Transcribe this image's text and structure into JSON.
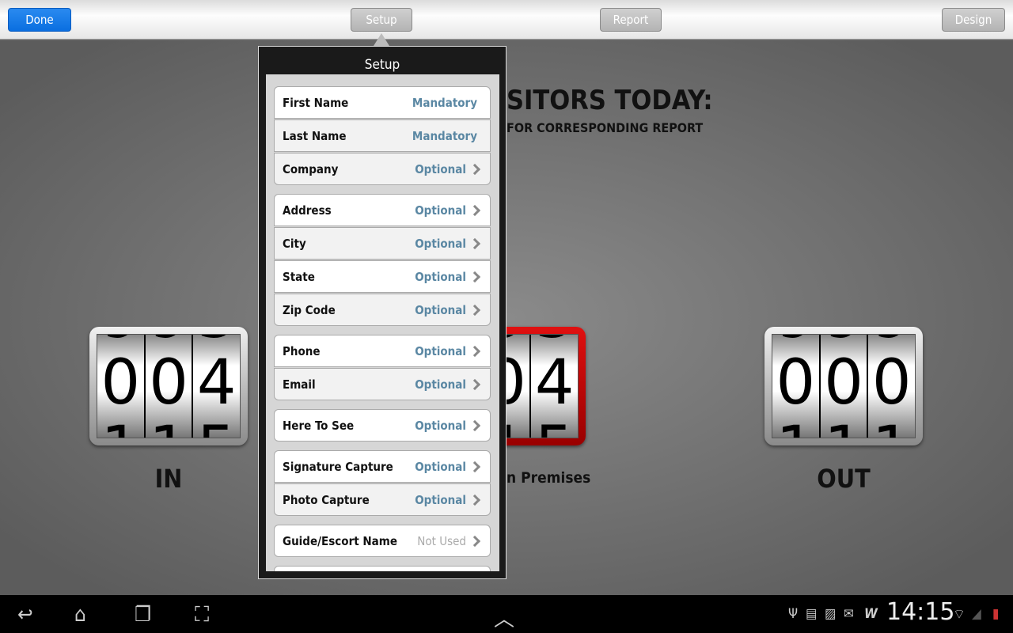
{
  "toolbar": {
    "done": "Done",
    "setup": "Setup",
    "report": "Report",
    "design": "Design",
    "accent": "#0a6fe0"
  },
  "main": {
    "title": "SITORS TODAY:",
    "subtitle": "FOR CORRESPONDING REPORT",
    "counters": [
      {
        "label": "IN",
        "digits": [
          "0",
          "0",
          "4"
        ],
        "prev": [
          "9",
          "9",
          "3"
        ],
        "next": [
          "1",
          "1",
          "5"
        ]
      },
      {
        "label": "n Premises",
        "digits": [
          "0",
          "4"
        ],
        "prev": [
          "9",
          "3"
        ],
        "next": [
          "1",
          "5"
        ],
        "color": "#cc0000"
      },
      {
        "label": "OUT",
        "digits": [
          "0",
          "0",
          "0"
        ],
        "prev": [
          "9",
          "9",
          "9"
        ],
        "next": [
          "1",
          "1",
          "1"
        ]
      }
    ]
  },
  "popup": {
    "title": "Setup",
    "rows": [
      {
        "label": "First Name",
        "value": "Mandatory",
        "chevron": false
      },
      {
        "label": "Last Name",
        "value": "Mandatory",
        "chevron": false
      },
      {
        "label": "Company",
        "value": "Optional",
        "chevron": true
      },
      {
        "label": "Address",
        "value": "Optional",
        "chevron": true
      },
      {
        "label": "City",
        "value": "Optional",
        "chevron": true
      },
      {
        "label": "State",
        "value": "Optional",
        "chevron": true
      },
      {
        "label": "Zip Code",
        "value": "Optional",
        "chevron": true
      },
      {
        "label": "Phone",
        "value": "Optional",
        "chevron": true
      },
      {
        "label": "Email",
        "value": "Optional",
        "chevron": true
      },
      {
        "label": "Here To See",
        "value": "Optional",
        "chevron": true
      },
      {
        "label": "Signature Capture",
        "value": "Optional",
        "chevron": true
      },
      {
        "label": "Photo Capture",
        "value": "Optional",
        "chevron": true
      },
      {
        "label": "Guide/Escort Name",
        "value": "Not Used",
        "chevron": true
      }
    ]
  },
  "statusbar": {
    "time": "14:15",
    "icons": [
      "usb-icon",
      "sd-card-icon",
      "gallery-icon",
      "email-icon",
      "w-app-icon",
      "wifi-icon",
      "signal-icon",
      "battery-icon"
    ]
  },
  "navbar": {
    "icons": [
      "back-icon",
      "home-icon",
      "recent-apps-icon",
      "screenshot-icon",
      "up-arrow-icon"
    ]
  }
}
